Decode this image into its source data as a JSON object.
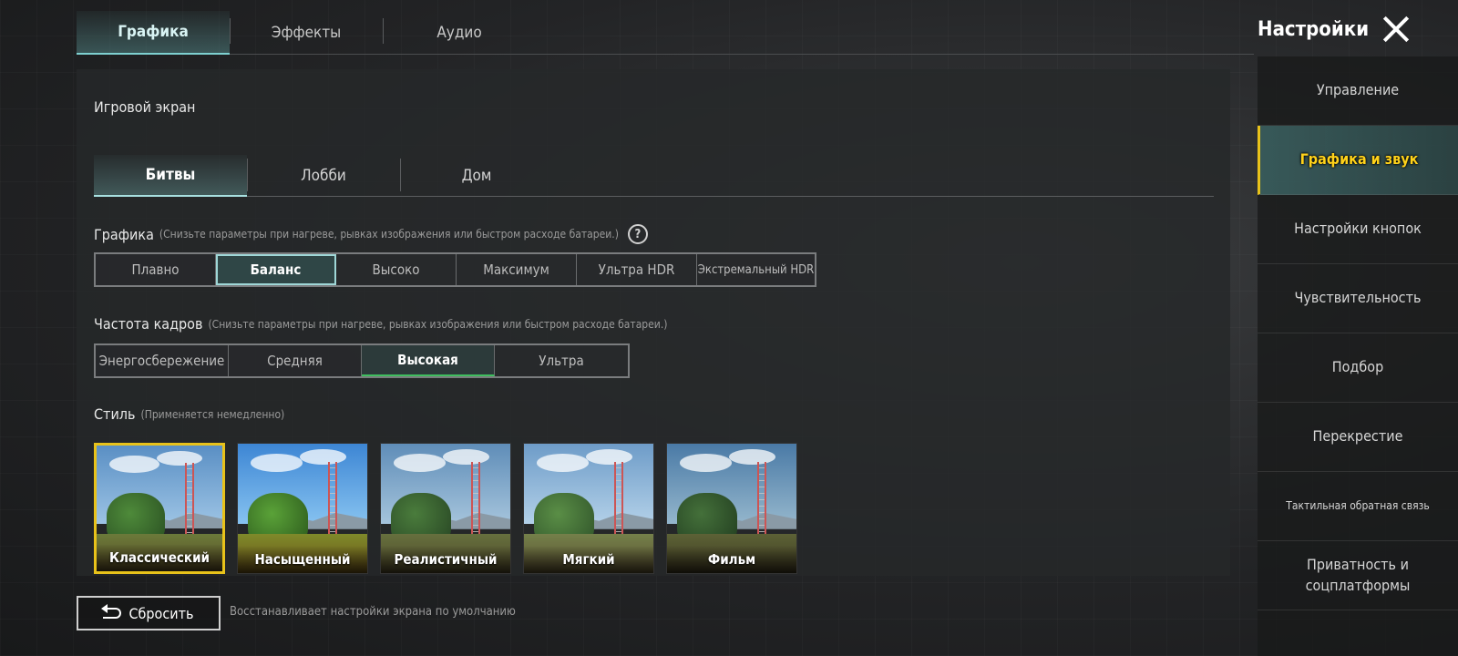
{
  "window": {
    "title": "Настройки"
  },
  "top_tabs": [
    {
      "label": "Графика",
      "active": true
    },
    {
      "label": "Эффекты",
      "active": false
    },
    {
      "label": "Аудио",
      "active": false
    }
  ],
  "sidebar": {
    "items": [
      {
        "label": "Управление",
        "active": false
      },
      {
        "label": "Графика и звук",
        "active": true
      },
      {
        "label": "Настройки кнопок",
        "active": false
      },
      {
        "label": "Чувствительность",
        "active": false
      },
      {
        "label": "Подбор",
        "active": false
      },
      {
        "label": "Перекрестие",
        "active": false
      },
      {
        "label": "Тактильная обратная связь",
        "active": false
      },
      {
        "label": "Приватность и соцплатформы",
        "active": false
      }
    ]
  },
  "main": {
    "section_title": "Игровой экран",
    "sub_tabs": [
      {
        "label": "Битвы",
        "active": true
      },
      {
        "label": "Лобби",
        "active": false
      },
      {
        "label": "Дом",
        "active": false
      }
    ],
    "graphics": {
      "label": "Графика",
      "hint": "(Снизьте параметры при нагреве, рывках изображения или быстром расходе батареи.)",
      "help_symbol": "?",
      "options": [
        "Плавно",
        "Баланс",
        "Высоко",
        "Максимум",
        "Ультра HDR",
        "Экстремальный HDR"
      ],
      "selected": "Баланс"
    },
    "frame_rate": {
      "label": "Частота кадров",
      "hint": "(Снизьте параметры при нагреве, рывках изображения или быстром расходе батареи.)",
      "options": [
        "Энергосбережение",
        "Средняя",
        "Высокая",
        "Ультра"
      ],
      "selected": "Высокая"
    },
    "style": {
      "label": "Стиль",
      "hint": "(Применяется немедленно)",
      "options": [
        "Классический",
        "Насыщенный",
        "Реалистичный",
        "Мягкий",
        "Фильм"
      ],
      "selected": "Классический"
    }
  },
  "footer": {
    "reset_label": "Сбросить",
    "reset_description": "Восстанавливает настройки экрана по умолчанию"
  },
  "colors": {
    "accent_teal": "#7ed0d0",
    "selected_yellow": "#e8c21a",
    "fps_green": "#3fbf5f"
  },
  "icons": {
    "close": "close-icon",
    "help": "help-icon",
    "reset": "reset-icon"
  }
}
